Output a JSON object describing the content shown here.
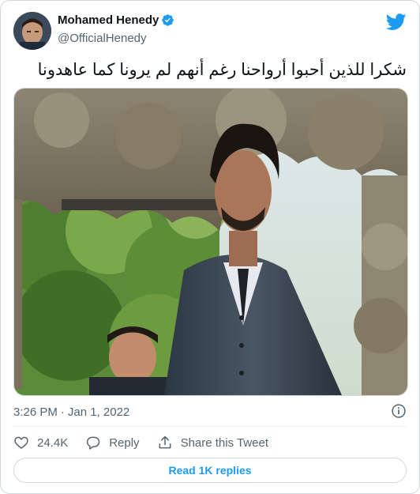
{
  "tweet": {
    "author": {
      "display_name": "Mohamed Henedy",
      "handle": "@OfficialHenedy",
      "verified": true
    },
    "text": "شكرا للذين أحبوا أرواحنا رغم أنهم لم يرونا كما عاهدونا",
    "timestamp": {
      "time": "3:26 PM",
      "separator": "·",
      "date": "Jan 1, 2022"
    },
    "actions": {
      "like_count": "24.4K",
      "reply_label": "Reply",
      "share_label": "Share this Tweet"
    },
    "read_replies_label": "Read 1K replies"
  },
  "colors": {
    "brand_blue": "#1d9bf0",
    "text_primary": "#0f1419",
    "text_secondary": "#536471",
    "border": "#cfd9de"
  },
  "icons": {
    "logo": "twitter-bird-icon",
    "verified": "verified-badge-icon",
    "info": "info-icon",
    "like": "heart-icon",
    "reply": "reply-bubble-icon",
    "share": "share-icon"
  }
}
